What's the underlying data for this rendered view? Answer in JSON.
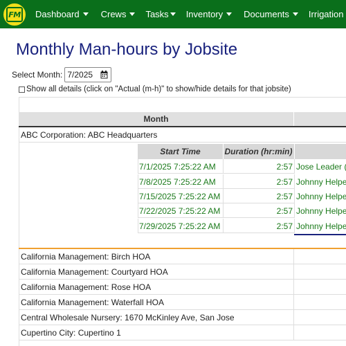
{
  "logo": {
    "text": "FM"
  },
  "nav": {
    "items": [
      {
        "label": "Dashboard",
        "key": "dashboard",
        "x": 0
      },
      {
        "label": "Crews",
        "key": "crews"
      },
      {
        "label": "Tasks",
        "key": "tasks"
      },
      {
        "label": "Inventory",
        "key": "inventory"
      },
      {
        "label": "Documents",
        "key": "documents"
      },
      {
        "label": "Irrigation",
        "key": "irrigation"
      }
    ]
  },
  "page": {
    "title": "Monthly Man-hours by Jobsite",
    "month_label": "Select Month:",
    "month_value": "7/2025",
    "show_all_label": "Show all details (click on \"Actual (m-h)\" to show/hide details for that jobsite)"
  },
  "table": {
    "header_month": "Month",
    "expanded_jobsite": "ABC Corporation: ABC Headquarters",
    "detail_headers": {
      "start_time": "Start Time",
      "duration": "Duration (hr:min)"
    },
    "details": [
      {
        "start": "7/1/2025 7:25:22 AM",
        "duration": "2:57",
        "worker": "Jose Leader ("
      },
      {
        "start": "7/8/2025 7:25:22 AM",
        "duration": "2:57",
        "worker": "Johnny Helpe"
      },
      {
        "start": "7/15/2025 7:25:22 AM",
        "duration": "2:57",
        "worker": "Johnny Helpe"
      },
      {
        "start": "7/22/2025 7:25:22 AM",
        "duration": "2:57",
        "worker": "Johnny Helpe"
      },
      {
        "start": "7/29/2025 7:25:22 AM",
        "duration": "2:57",
        "worker": "Johnny Helpe"
      }
    ],
    "jobsites": [
      "California Management: Birch HOA",
      "California Management: Courtyard HOA",
      "California Management: Rose HOA",
      "California Management: Waterfall HOA",
      "Central Wholesale Nursery: 1670 McKinley Ave, San Jose",
      "Cupertino City: Cupertino 1"
    ]
  }
}
